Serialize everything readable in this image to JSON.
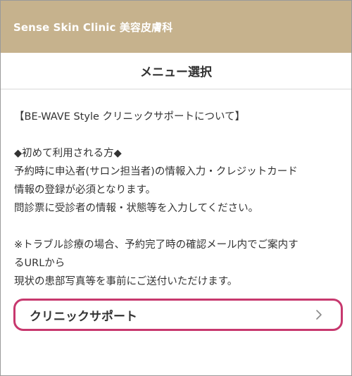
{
  "header": {
    "title": "Sense Skin Clinic 美容皮膚科"
  },
  "page": {
    "title": "メニュー選択"
  },
  "info": {
    "heading": "【BE-WAVE Style クリニックサポートについて】",
    "first_time_heading": "◆初めて利用される方◆",
    "first_time_line1": "予約時に申込者(サロン担当者)の情報入力・クレジットカード",
    "first_time_line2": "情報の登録が必須となります。",
    "questionnaire": "問診票に受診者の情報・状態等を入力してください。",
    "trouble_line1": "※トラブル診療の場合、予約完了時の確認メール内でご案内す",
    "trouble_line2": "るURLから",
    "trouble_line3": "現状の患部写真等を事前にご送付いただけます。"
  },
  "menu": {
    "clinic_support_label": "クリニックサポート",
    "chevron_icon": "chevron-right-icon"
  },
  "colors": {
    "header_bg": "#c6b28d",
    "card_border": "#c7386e"
  }
}
